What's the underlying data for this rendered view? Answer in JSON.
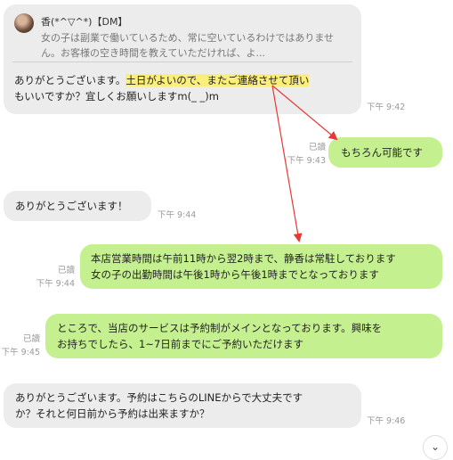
{
  "messages": {
    "m1": {
      "quote_name": "香(*^▽^*)【DM】",
      "quote_text": "女の子は副業で働いているため、常に空いているわけではありません。お客様の空き時間を教えていただければ、よ...",
      "text_before": "ありがとうございます。",
      "text_highlight": "土日がよいので、またご連絡させて頂い",
      "text_after": "もいいですか？宜しくお願いしますm(_ _)m",
      "time": "下午 9:42"
    },
    "m2": {
      "read": "已讀",
      "time": "下午 9:43",
      "text": "もちろん可能です"
    },
    "m3": {
      "text": "ありがとうございます！",
      "time": "下午 9:44"
    },
    "m4": {
      "read": "已讀",
      "time": "下午 9:44",
      "line1": "本店営業時間は午前11時から翌2時まで、静香は常駐しております",
      "line2": "女の子の出勤時間は午後1時から午後1時までとなっております"
    },
    "m5": {
      "read": "已讀",
      "time": "下午 9:45",
      "line1": "ところで、当店のサービスは予約制がメインとなっております。興味を",
      "line2": "お持ちでしたら、1~7日前までにご予約いただけます"
    },
    "m6": {
      "line1": "ありがとうございます。予約はこちらのLINEからで大丈夫です",
      "line2": "か？それと何日前から予約は出来ますか？",
      "time": "下午 9:46"
    }
  },
  "colors": {
    "incoming": "#ececec",
    "outgoing": "#c5f08f",
    "highlight": "#fbee7a",
    "arrow": "#e53935"
  },
  "icons": {
    "corner": "chevron-down-icon"
  }
}
